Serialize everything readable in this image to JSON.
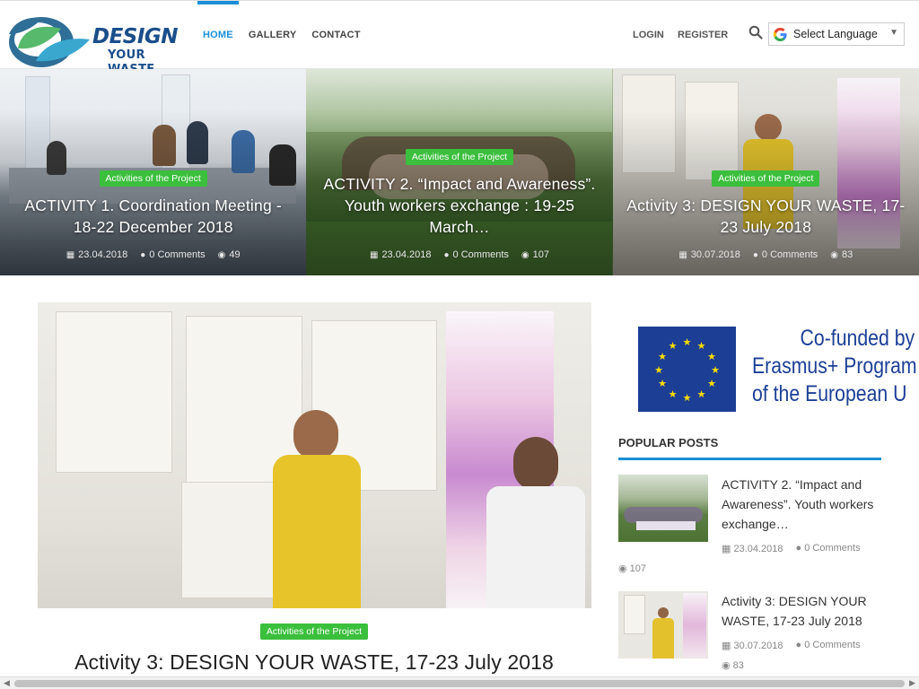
{
  "header": {
    "logo_title": "DESIGN",
    "logo_sub": "YOUR WASTE",
    "nav": [
      {
        "label": "HOME",
        "active": true
      },
      {
        "label": "GALLERY",
        "active": false
      },
      {
        "label": "CONTACT",
        "active": false
      }
    ],
    "login": "LOGIN",
    "register": "REGISTER",
    "language": "Select Language"
  },
  "slider": [
    {
      "category": "Activities of the Project",
      "title": "ACTIVITY 1. Coordination Meeting - 18-22 December 2018",
      "date": "23.04.2018",
      "comments": "0 Comments",
      "views": "49"
    },
    {
      "category": "Activities of the Project",
      "title": "ACTIVITY 2. “Impact and Awareness”. Youth workers exchange : 19-25 March…",
      "date": "23.04.2018",
      "comments": "0 Comments",
      "views": "107"
    },
    {
      "category": "Activities of the Project",
      "title": "Activity 3: DESIGN YOUR WASTE, 17-23 July 2018",
      "date": "30.07.2018",
      "comments": "0 Comments",
      "views": "83"
    }
  ],
  "main_post": {
    "category": "Activities of the Project",
    "title": "Activity 3: DESIGN YOUR WASTE, 17-23 July 2018"
  },
  "sidebar": {
    "eu_text": [
      "Co-funded by",
      "Erasmus+ Program",
      "of the European U"
    ],
    "popular_heading": "POPULAR POSTS",
    "posts": [
      {
        "title": "ACTIVITY 2. “Impact and Awareness”. Youth workers exchange…",
        "date": "23.04.2018",
        "comments": "0 Comments",
        "views": "107"
      },
      {
        "title": "Activity 3: DESIGN YOUR WASTE, 17-23 July 2018",
        "date": "30.07.2018",
        "comments": "0 Comments",
        "views": "83"
      }
    ]
  },
  "colors": {
    "accent": "#1a8fd8",
    "category_badge": "#3bbf3d",
    "logo_blue": "#1a4e8a"
  },
  "icons": [
    "search-icon",
    "google-icon",
    "calendar-icon",
    "comment-icon",
    "eye-icon"
  ]
}
